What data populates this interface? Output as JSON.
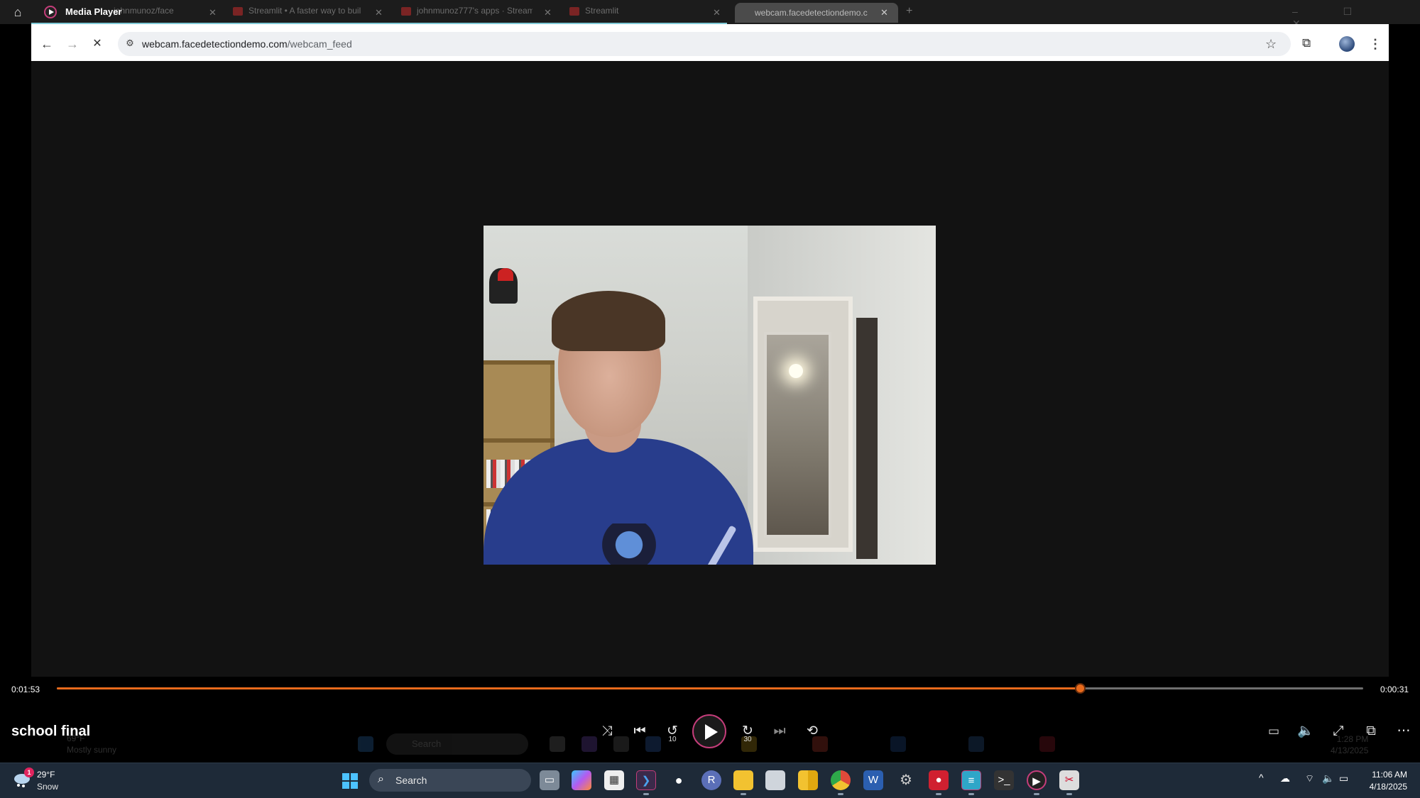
{
  "media_player": {
    "app_title": "Media Player",
    "media_title": "school final",
    "time_current": "0:01:53",
    "time_total": "0:00:31",
    "progress": 0.783,
    "accent_color": "#e86a1c"
  },
  "recorded_browser": {
    "tabs": [
      {
        "label": "johnmunoz/face"
      },
      {
        "label": "Streamlit • A faster way to buil"
      },
      {
        "label": "johnmunoz777's apps · Stream"
      },
      {
        "label": "Streamlit"
      },
      {
        "label": "webcam.facedetectiondemo.c"
      }
    ],
    "new_tab": "+",
    "url_host": "webcam.facedetectiondemo.com",
    "url_path": "/webcam_feed"
  },
  "ghost_taskbar": {
    "weather_temp": "69°F",
    "weather_cond": "Mostly sunny",
    "search": "Search",
    "time": "1:28 PM",
    "date": "4/13/2025"
  },
  "taskbar": {
    "weather_badge": "1",
    "weather_temp": "29°F",
    "weather_cond": "Snow",
    "search_placeholder": "Search",
    "time": "11:06 AM",
    "date": "4/18/2025"
  }
}
